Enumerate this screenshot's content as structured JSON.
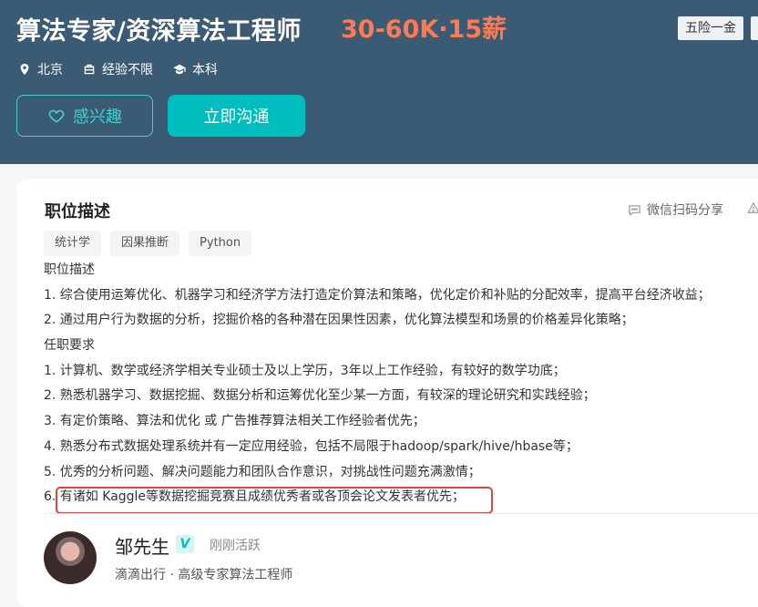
{
  "header": {
    "job_title": "算法专家/资深算法工程师",
    "salary": "30-60K·15薪",
    "welfare_tag": "五险一金",
    "location": "北京",
    "experience": "经验不限",
    "education": "本科",
    "interest_button": "感兴趣",
    "chat_button": "立即沟通"
  },
  "job": {
    "section_title": "职位描述",
    "share_label": "微信扫码分享",
    "tags": [
      "统计学",
      "因果推断",
      "Python"
    ],
    "description_lines": [
      "职位描述",
      "1. 综合使用运筹优化、机器学习和经济学方法打造定价算法和策略，优化定价和补贴的分配效率，提高平台经济收益；",
      "2. 通过用户行为数据的分析，挖掘价格的各种潜在因果性因素，优化算法模型和场景的价格差异化策略；",
      "任职要求",
      "1. 计算机、数学或经济学相关专业硕士及以上学历，3年以上工作经验，有较好的数学功底；",
      "2. 熟悉机器学习、数据挖掘、数据分析和运筹优化至少某一方面，有较深的理论研究和实践经验；",
      "3. 有定价策略、算法和优化 或 广告推荐算法相关工作经验者优先；",
      "4. 熟悉分布式数据处理系统并有一定应用经验，包括不局限于hadoop/spark/hive/hbase等；",
      "5. 优秀的分析问题、解决问题能力和团队合作意识，对挑战性问题充满激情；",
      "6. 有诸如 Kaggle等数据挖掘竞赛且成绩优秀者或各顶会论文发表者优先；"
    ]
  },
  "recruiter": {
    "name": "邹先生",
    "verified_icon_label": "V",
    "active_status": "刚刚活跃",
    "company_title": "滴滴出行 · 高级专家算法工程师"
  },
  "colors": {
    "header_bg": "#3b5a74",
    "salary": "#fe7b52",
    "accent": "#00bebd",
    "highlight_border": "#e2443a"
  },
  "icons": {
    "location": "location-pin-icon",
    "experience": "briefcase-icon",
    "education": "graduation-cap-icon",
    "interest": "heart-outline-icon",
    "share": "chat-bubble-icon",
    "report": "warning-triangle-icon"
  }
}
